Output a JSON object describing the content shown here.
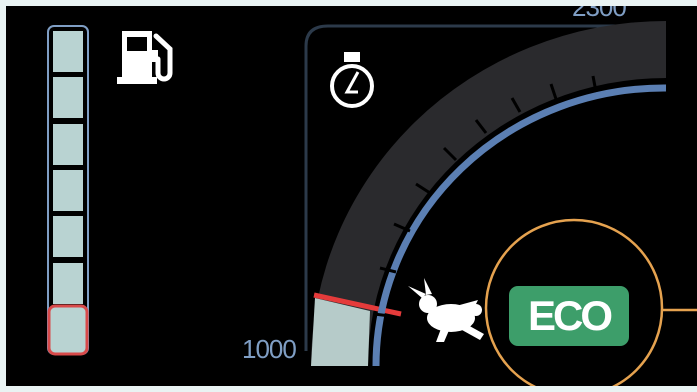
{
  "gauge": {
    "max_label": "2300",
    "min_label": "1000"
  },
  "fuel": {
    "segments_total": 7,
    "low_segment_color": "#d84a4a",
    "segment_color": "#b9d3d2"
  },
  "mode": {
    "badge_label": "ECO",
    "badge_color": "#3d9e6a",
    "highlight_color": "#e5a24f"
  },
  "icons": {
    "fuel": "fuel-pump-icon",
    "engine": "engine-oil-icon",
    "speed_mode": "rabbit-icon"
  },
  "colors": {
    "ticks": "#5b7fb3",
    "needle": "#e53b3b",
    "arc": "#2a2a2d"
  }
}
